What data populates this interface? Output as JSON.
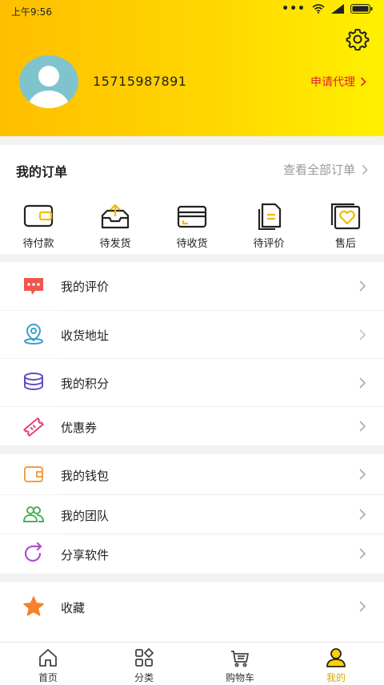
{
  "status_bar": {
    "time": "上午9:56"
  },
  "profile": {
    "phone": "15715987891",
    "agent_link": "申请代理"
  },
  "orders": {
    "title": "我的订单",
    "view_all": "查看全部订单",
    "items": [
      {
        "label": "待付款",
        "icon": "wallet-icon"
      },
      {
        "label": "待发货",
        "icon": "box-upload-icon"
      },
      {
        "label": "待收货",
        "icon": "card-receive-icon"
      },
      {
        "label": "待评价",
        "icon": "document-icon"
      },
      {
        "label": "售后",
        "icon": "heart-card-icon"
      }
    ]
  },
  "menu": [
    {
      "label": "我的评价",
      "icon": "chat-bubble-icon",
      "color": "#f0564f"
    },
    {
      "label": "收货地址",
      "icon": "location-pin-icon",
      "color": "#3aa0c8"
    },
    {
      "label": "我的积分",
      "icon": "coin-stack-icon",
      "color": "#5a4fc6"
    },
    {
      "label": "优惠券",
      "icon": "ticket-icon",
      "color": "#e0427a"
    },
    {
      "label": "我的钱包",
      "icon": "wallet-icon",
      "color": "#f0a046"
    },
    {
      "label": "我的团队",
      "icon": "team-icon",
      "color": "#4cb05a"
    },
    {
      "label": "分享软件",
      "icon": "share-icon",
      "color": "#b04fd0"
    },
    {
      "label": "收藏",
      "icon": "star-icon",
      "color": "#f5822a"
    }
  ],
  "tabs": [
    {
      "label": "首页",
      "icon": "home-icon"
    },
    {
      "label": "分类",
      "icon": "grid-icon"
    },
    {
      "label": "购物车",
      "icon": "cart-icon"
    },
    {
      "label": "我的",
      "icon": "person-icon",
      "active": true
    }
  ],
  "colors": {
    "accent": "#ffd000",
    "active_tab": "#e0a800",
    "agent_link": "#e0202a"
  }
}
